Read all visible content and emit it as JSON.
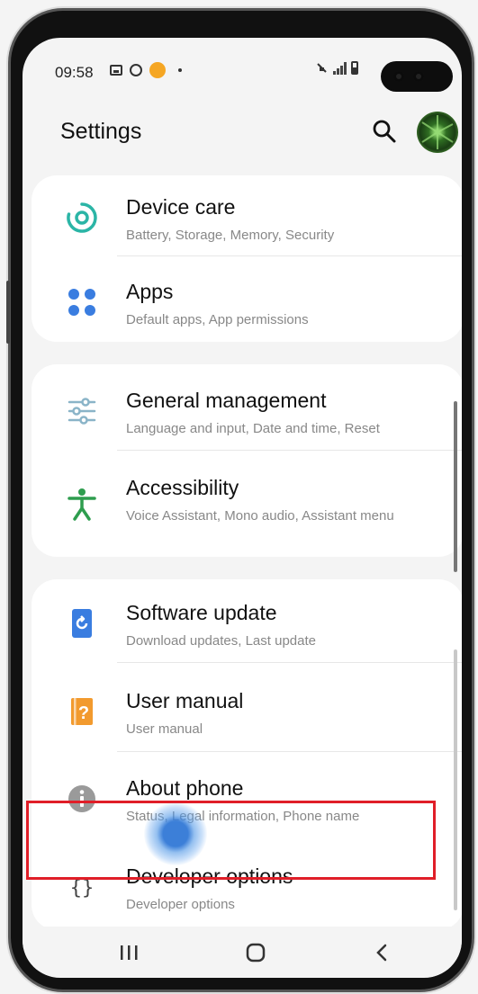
{
  "status_bar": {
    "time": "09:58",
    "icons": [
      "gallery-icon",
      "ring-icon",
      "orange-badge-icon",
      "dot-icon",
      "mute-vibrate-icon",
      "signal-icon",
      "battery-icon"
    ]
  },
  "header": {
    "title": "Settings",
    "search_icon": "search-icon",
    "avatar_icon": "profile-avatar"
  },
  "groups": [
    {
      "items": [
        {
          "title": "Device care",
          "subtitle": "Battery, Storage, Memory, Security",
          "icon": "device-care-icon"
        },
        {
          "title": "Apps",
          "subtitle": "Default apps, App permissions",
          "icon": "apps-icon"
        }
      ]
    },
    {
      "items": [
        {
          "title": "General management",
          "subtitle": "Language and input, Date and time, Reset",
          "icon": "sliders-icon"
        },
        {
          "title": "Accessibility",
          "subtitle": "Voice Assistant, Mono audio, Assistant menu",
          "icon": "accessibility-icon"
        }
      ]
    },
    {
      "items": [
        {
          "title": "Software update",
          "subtitle": "Download updates, Last update",
          "icon": "software-update-icon"
        },
        {
          "title": "User manual",
          "subtitle": "User manual",
          "icon": "user-manual-icon"
        },
        {
          "title": "About phone",
          "subtitle": "Status, Legal information, Phone name",
          "icon": "info-icon"
        },
        {
          "title": "Developer options",
          "subtitle": "Developer options",
          "icon": "braces-icon"
        }
      ]
    }
  ],
  "colors": {
    "teal": "#2bb5a6",
    "blue": "#3a7de0",
    "orange": "#f29a2e",
    "green": "#2e9d4e",
    "highlight": "#e01e28"
  },
  "navbar": {
    "icons": [
      "recent-apps-icon",
      "home-icon",
      "back-icon"
    ]
  }
}
